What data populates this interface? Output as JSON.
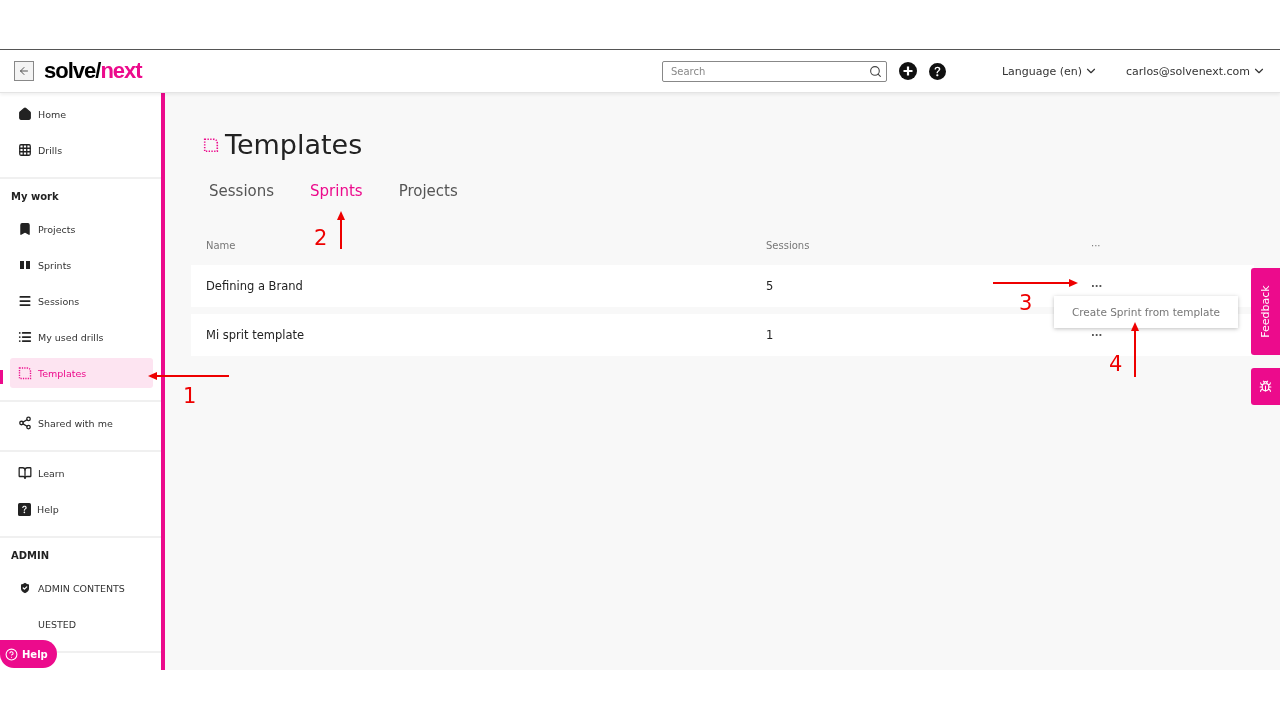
{
  "header": {
    "logo": {
      "dark": "solve/",
      "accent": "next"
    },
    "search": {
      "placeholder": "Search"
    },
    "language": "Language (en)",
    "user": "carlos@solvenext.com"
  },
  "sidebar": {
    "sections": [
      {
        "items": [
          {
            "label": "Home",
            "selected": false
          },
          {
            "label": "Drills",
            "selected": false
          }
        ]
      },
      {
        "heading": "My work",
        "items": [
          {
            "label": "Projects",
            "selected": false
          },
          {
            "label": "Sprints",
            "selected": false
          },
          {
            "label": "Sessions",
            "selected": false
          },
          {
            "label": "My used drills",
            "selected": false
          },
          {
            "label": "Templates",
            "selected": true
          }
        ]
      },
      {
        "items": [
          {
            "label": "Shared with me",
            "selected": false
          }
        ]
      },
      {
        "items": [
          {
            "label": "Learn",
            "selected": false
          },
          {
            "label": "Help",
            "selected": false
          }
        ]
      },
      {
        "heading": "ADMIN",
        "items": [
          {
            "label": "ADMIN CONTENTS",
            "selected": false
          },
          {
            "label": "UESTED",
            "selected": false
          }
        ]
      }
    ]
  },
  "help_button": "Help",
  "page": {
    "title": "Templates",
    "tabs": [
      {
        "label": "Sessions",
        "selected": false
      },
      {
        "label": "Sprints",
        "selected": true
      },
      {
        "label": "Projects",
        "selected": false
      }
    ],
    "table": {
      "columns": [
        "Name",
        "Sessions",
        "···"
      ],
      "rows": [
        {
          "name": "Defining a Brand",
          "sessions": "5",
          "menu": "···"
        },
        {
          "name": "Mi sprit template",
          "sessions": "1",
          "menu": "···"
        }
      ]
    },
    "menu": {
      "items": [
        "Create Sprint from template"
      ]
    }
  },
  "feedback": "Feedback",
  "annotations": [
    {
      "label": "1"
    },
    {
      "label": "2"
    },
    {
      "label": "3"
    },
    {
      "label": "4"
    }
  ]
}
